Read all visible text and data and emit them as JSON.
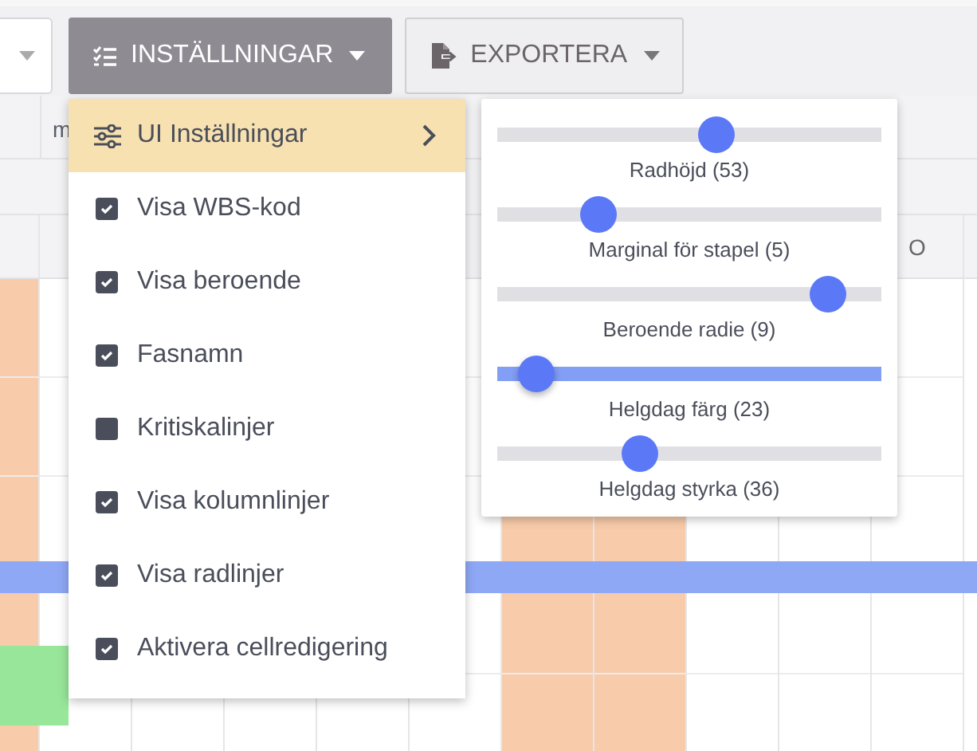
{
  "toolbar": {
    "buttons": [
      {
        "kind": "select"
      },
      {
        "kind": "menu",
        "label": "INSTÄLLNINGAR",
        "selected": true
      },
      {
        "kind": "menu",
        "label": "EXPORTERA",
        "selected": false
      }
    ]
  },
  "grid": {
    "header_text": "m",
    "column_label": "O",
    "columns": [
      {
        "weekend": true
      },
      {
        "weekend": false
      },
      {
        "weekend": false
      },
      {
        "weekend": false
      },
      {
        "weekend": false
      },
      {
        "weekend": false
      },
      {
        "weekend": true
      },
      {
        "weekend": true
      },
      {
        "weekend": false
      },
      {
        "weekend": false
      },
      {
        "weekend": false
      }
    ],
    "bars": [
      {
        "color": "#8fa8f5"
      },
      {
        "color": "#98e69a"
      }
    ]
  },
  "menu": {
    "items": [
      {
        "kind": "submenu",
        "label": "UI Inställningar",
        "selected": true
      },
      {
        "kind": "check",
        "label": "Visa WBS-kod",
        "checked": true
      },
      {
        "kind": "check",
        "label": "Visa beroende",
        "checked": true
      },
      {
        "kind": "check",
        "label": "Fasnamn",
        "checked": true
      },
      {
        "kind": "check",
        "label": "Kritiskalinjer",
        "checked": false
      },
      {
        "kind": "check",
        "label": "Visa kolumnlinjer",
        "checked": true
      },
      {
        "kind": "check",
        "label": "Visa radlinjer",
        "checked": true
      },
      {
        "kind": "check",
        "label": "Aktivera cellredigering",
        "checked": true
      }
    ]
  },
  "submenu": {
    "sliders": [
      {
        "label": "Radhöjd (53)",
        "level": 0.57,
        "focused": false
      },
      {
        "label": "Marginal för stapel (5)",
        "level": 0.26,
        "focused": false
      },
      {
        "label": "Beroende radie (9)",
        "level": 0.86,
        "focused": false
      },
      {
        "label": "Helgdag färg (23)",
        "level": 0.1,
        "focused": true
      },
      {
        "label": "Helgdag styrka (36)",
        "level": 0.37,
        "focused": false
      }
    ]
  }
}
